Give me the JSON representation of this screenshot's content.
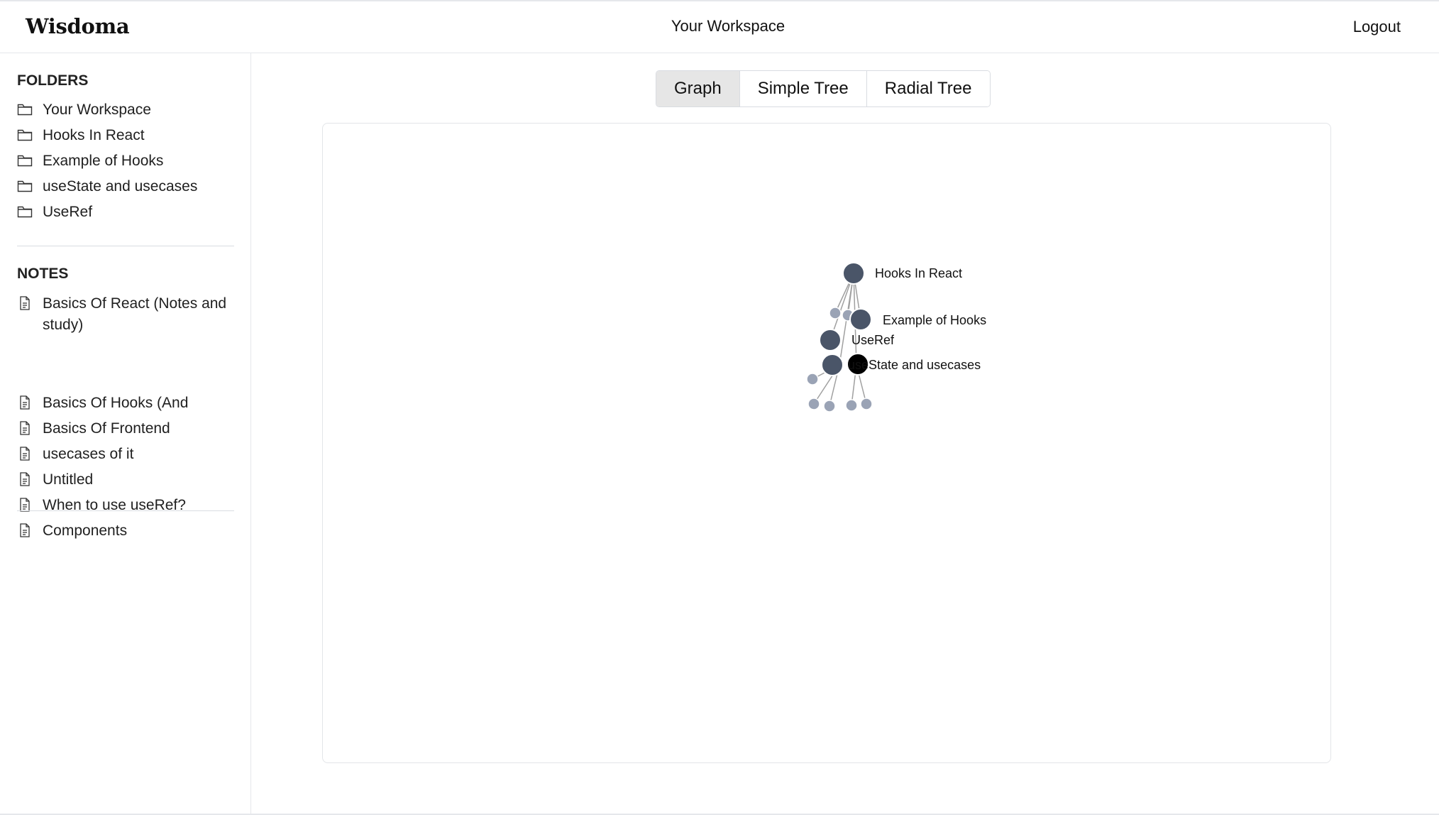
{
  "header": {
    "logo": "Wisdoma",
    "workspace_title": "Your Workspace",
    "logout_label": "Logout"
  },
  "sidebar": {
    "folders_title": "FOLDERS",
    "folders": [
      {
        "label": "Your Workspace",
        "icon": "folder-icon"
      },
      {
        "label": "Hooks In React",
        "icon": "folder-icon"
      },
      {
        "label": "Example of Hooks",
        "icon": "folder-icon"
      },
      {
        "label": "useState and usecases",
        "icon": "folder-icon"
      },
      {
        "label": "UseRef",
        "icon": "folder-icon"
      }
    ],
    "notes_title": "NOTES",
    "notes": [
      {
        "label": "Basics Of React (Notes and study)",
        "icon": "document-icon"
      },
      {
        "label": "Basics Of Hooks (And",
        "icon": "document-icon"
      },
      {
        "label": "Basics Of Frontend",
        "icon": "document-icon"
      },
      {
        "label": "usecases of it",
        "icon": "document-icon"
      },
      {
        "label": "Untitled",
        "icon": "document-icon"
      },
      {
        "label": "When to use useRef?",
        "icon": "document-icon"
      },
      {
        "label": "Components",
        "icon": "document-icon"
      }
    ]
  },
  "view_tabs": [
    {
      "label": "Graph",
      "active": true
    },
    {
      "label": "Simple Tree",
      "active": false
    },
    {
      "label": "Radial Tree",
      "active": false
    }
  ],
  "graph": {
    "colors": {
      "folder_node": "#4a5568",
      "note_node": "#9aa3b5",
      "selected_node": "#000000",
      "link": "#a0a0a0"
    },
    "folder_nodes": [
      {
        "id": "hooks",
        "label": "Hooks In React"
      },
      {
        "id": "example",
        "label": "Example of Hooks"
      },
      {
        "id": "useref",
        "label": "UseRef"
      },
      {
        "id": "workspace",
        "label": ""
      },
      {
        "id": "usestate",
        "label": "useState and usecases",
        "selected": true
      }
    ],
    "note_node_count": 8
  }
}
